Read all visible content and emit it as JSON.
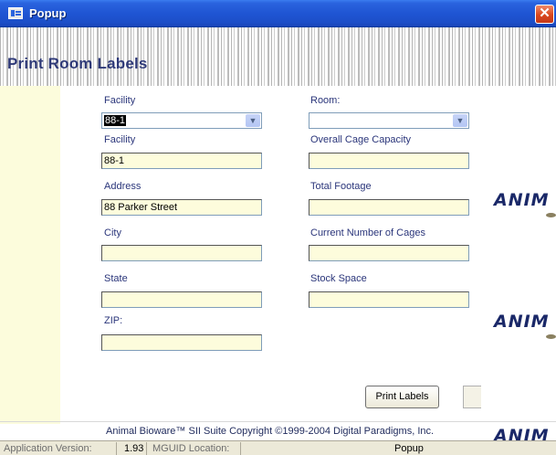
{
  "window": {
    "title": "Popup",
    "close_glyph": "✕"
  },
  "header": {
    "title": "Print Room Labels"
  },
  "form": {
    "facility_combo": {
      "label": "Facility",
      "value": "88-1"
    },
    "room_combo": {
      "label": "Room:",
      "value": ""
    },
    "facility": {
      "label": "Facility",
      "value": "88-1"
    },
    "address": {
      "label": "Address",
      "value": "88 Parker Street"
    },
    "city": {
      "label": "City",
      "value": ""
    },
    "state": {
      "label": "State",
      "value": ""
    },
    "zip": {
      "label": "ZIP:",
      "value": ""
    },
    "overall_cage_capacity": {
      "label": "Overall Cage Capacity",
      "value": ""
    },
    "total_footage": {
      "label": "Total Footage",
      "value": ""
    },
    "current_number_of_cages": {
      "label": "Current Number of Cages",
      "value": ""
    },
    "stock_space": {
      "label": "Stock Space",
      "value": ""
    }
  },
  "buttons": {
    "print_labels": "Print Labels"
  },
  "logos": [
    "ANIM",
    "ANIM",
    "ANIM"
  ],
  "footer": {
    "copyright": "Animal Bioware™ SII Suite Copyright ©1999-2004 Digital Paradigms, Inc."
  },
  "statusbar": {
    "app_version_label": "Application Version:",
    "app_version": "1.93",
    "mguid_label": "MGUID Location:",
    "form_name": "Popup"
  },
  "icons": {
    "title_icon": "form-window-icon",
    "dropdown": "chevron-down-icon"
  }
}
